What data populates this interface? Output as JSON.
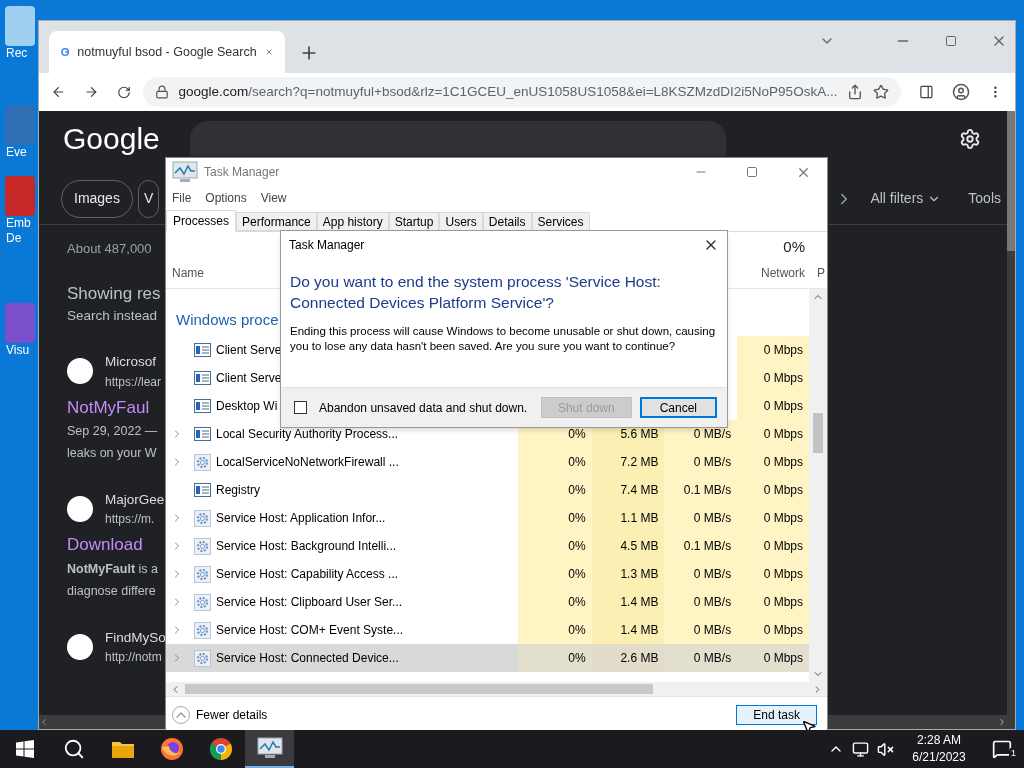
{
  "desktop_icons": [
    {
      "lines": [
        "Rec"
      ]
    },
    {
      "lines": [
        "Eve"
      ]
    },
    {
      "lines": [
        "Emb",
        "De"
      ]
    },
    {
      "lines": [
        "Visu"
      ]
    }
  ],
  "browser": {
    "tab_title": "notmuyful bsod - Google Search",
    "url_host": "google.com",
    "url_path": "/search?q=notmuyful+bsod&rlz=1C1GCEU_enUS1058US1058&ei=L8KSZMzdDI2i5NoP95OskA..."
  },
  "google": {
    "logo": "Google",
    "chips": [
      "Images",
      "V"
    ],
    "all_filters": "All filters",
    "tools": "Tools",
    "result_stats": "About 487,000",
    "showing": "Showing res",
    "search_instead": "Search instead",
    "results": [
      {
        "source": "Microsof",
        "url": "https://lear",
        "title": "NotMyFaul",
        "snippet": [
          "Sep 29, 2022 —",
          "leaks on your W"
        ]
      },
      {
        "source": "MajorGee",
        "url": "https://m.",
        "title": "Download",
        "snippet": [
          "**NotMyFault** is a",
          "diagnose differe"
        ]
      },
      {
        "source": "FindMySo",
        "url": "http://notm"
      }
    ]
  },
  "task_manager": {
    "title": "Task Manager",
    "menu": [
      "File",
      "Options",
      "View"
    ],
    "tabs": [
      {
        "label": "Processes",
        "selected": true
      },
      {
        "label": "Performance",
        "selected": false
      },
      {
        "label": "App history",
        "selected": false
      },
      {
        "label": "Startup",
        "selected": false
      },
      {
        "label": "Users",
        "selected": false
      },
      {
        "label": "Details",
        "selected": false
      },
      {
        "label": "Services",
        "selected": false
      }
    ],
    "columns": {
      "name": "Name",
      "network_usage": "0%",
      "network": "Network",
      "column_6": "P"
    },
    "group": "Windows proce",
    "rows": [
      {
        "name": "Client Serve",
        "kind": "app",
        "expandable": false,
        "network": "0 Mbps",
        "selected": false
      },
      {
        "name": "Client Serve",
        "kind": "app",
        "expandable": false,
        "network": "0 Mbps",
        "selected": false
      },
      {
        "name": "Desktop Wi",
        "kind": "app",
        "expandable": false,
        "network": "0 Mbps",
        "selected": false
      },
      {
        "name": "Local Security Authority Process...",
        "kind": "app",
        "expandable": true,
        "cpu": "0%",
        "memory": "5.6 MB",
        "disk": "0 MB/s",
        "network": "0 Mbps",
        "selected": false
      },
      {
        "name": "LocalServiceNoNetworkFirewall ...",
        "kind": "service",
        "expandable": true,
        "cpu": "0%",
        "memory": "7.2 MB",
        "disk": "0 MB/s",
        "network": "0 Mbps",
        "selected": false
      },
      {
        "name": "Registry",
        "kind": "app",
        "expandable": false,
        "cpu": "0%",
        "memory": "7.4 MB",
        "disk": "0.1 MB/s",
        "network": "0 Mbps",
        "selected": false
      },
      {
        "name": "Service Host: Application Infor...",
        "kind": "service",
        "expandable": true,
        "cpu": "0%",
        "memory": "1.1 MB",
        "disk": "0 MB/s",
        "network": "0 Mbps",
        "selected": false
      },
      {
        "name": "Service Host: Background Intelli...",
        "kind": "service",
        "expandable": true,
        "cpu": "0%",
        "memory": "4.5 MB",
        "disk": "0.1 MB/s",
        "network": "0 Mbps",
        "selected": false
      },
      {
        "name": "Service Host: Capability Access ...",
        "kind": "service",
        "expandable": true,
        "cpu": "0%",
        "memory": "1.3 MB",
        "disk": "0 MB/s",
        "network": "0 Mbps",
        "selected": false
      },
      {
        "name": "Service Host: Clipboard User Ser...",
        "kind": "service",
        "expandable": true,
        "cpu": "0%",
        "memory": "1.4 MB",
        "disk": "0 MB/s",
        "network": "0 Mbps",
        "selected": false
      },
      {
        "name": "Service Host: COM+ Event Syste...",
        "kind": "service",
        "expandable": true,
        "cpu": "0%",
        "memory": "1.4 MB",
        "disk": "0 MB/s",
        "network": "0 Mbps",
        "selected": false
      },
      {
        "name": "Service Host: Connected Device...",
        "kind": "service",
        "expandable": true,
        "cpu": "0%",
        "memory": "2.6 MB",
        "disk": "0 MB/s",
        "network": "0 Mbps",
        "selected": true
      }
    ],
    "fewer_details": "Fewer details",
    "end_task": "End task"
  },
  "dialog": {
    "title": "Task Manager",
    "heading": "Do you want to end the system process 'Service Host: Connected Devices Platform Service'?",
    "body": "Ending this process will cause Windows to become unusable or shut down, causing you to lose any data hasn't been saved. Are you sure you want to continue?",
    "checkbox": {
      "label": "Abandon unsaved data and shut down.",
      "checked": false
    },
    "buttons": [
      {
        "label": "Shut down",
        "disabled": true,
        "default": false
      },
      {
        "label": "Cancel",
        "disabled": false,
        "default": true
      }
    ]
  },
  "taskbar": {
    "items": [
      {
        "kind": "start",
        "active": false
      },
      {
        "kind": "search",
        "active": false
      },
      {
        "kind": "explorer",
        "active": false
      },
      {
        "kind": "firefox",
        "active": false
      },
      {
        "kind": "chrome",
        "active": false
      },
      {
        "kind": "taskmgr",
        "active": true
      }
    ],
    "tray": [
      {
        "kind": "chevron"
      },
      {
        "kind": "network"
      },
      {
        "kind": "volume-muted"
      }
    ],
    "time": "2:28 AM",
    "date": "6/21/2023",
    "notifications": "1"
  }
}
